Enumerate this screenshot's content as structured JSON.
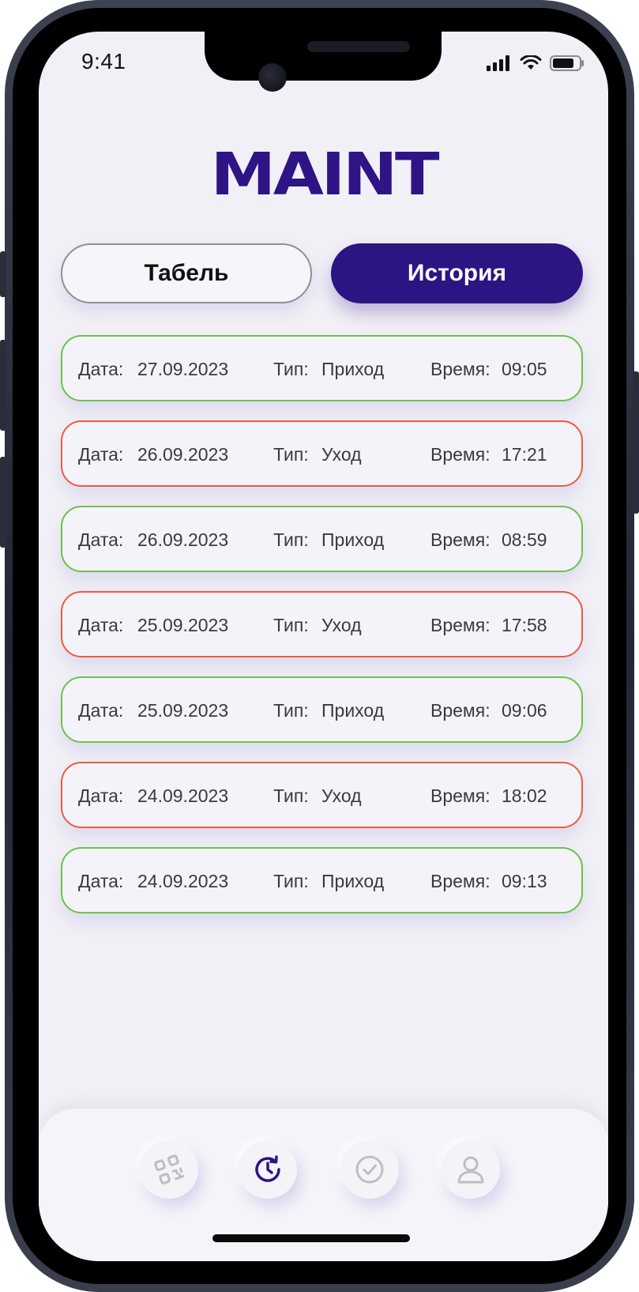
{
  "status_bar": {
    "time": "9:41"
  },
  "logo": {
    "text": "MAINT"
  },
  "tabs": {
    "tabel_label": "Табель",
    "history_label": "История",
    "active": "История"
  },
  "record_labels": {
    "date": "Дата:",
    "type": "Тип:",
    "time": "Время:"
  },
  "records": [
    {
      "date": "27.09.2023",
      "type": "Приход",
      "time": "09:05",
      "kind": "in"
    },
    {
      "date": "26.09.2023",
      "type": "Уход",
      "time": "17:21",
      "kind": "out"
    },
    {
      "date": "26.09.2023",
      "type": "Приход",
      "time": "08:59",
      "kind": "in"
    },
    {
      "date": "25.09.2023",
      "type": "Уход",
      "time": "17:58",
      "kind": "out"
    },
    {
      "date": "25.09.2023",
      "type": "Приход",
      "time": "09:06",
      "kind": "in"
    },
    {
      "date": "24.09.2023",
      "type": "Уход",
      "time": "18:02",
      "kind": "out"
    },
    {
      "date": "24.09.2023",
      "type": "Приход",
      "time": "09:13",
      "kind": "in"
    }
  ],
  "colors": {
    "brand": "#2d1483",
    "in_border": "#6cc24a",
    "out_border": "#ef5b3f"
  },
  "nav": {
    "items": [
      "qr-code-icon",
      "history-icon",
      "check-circle-icon",
      "user-icon"
    ],
    "active": "history-icon"
  }
}
